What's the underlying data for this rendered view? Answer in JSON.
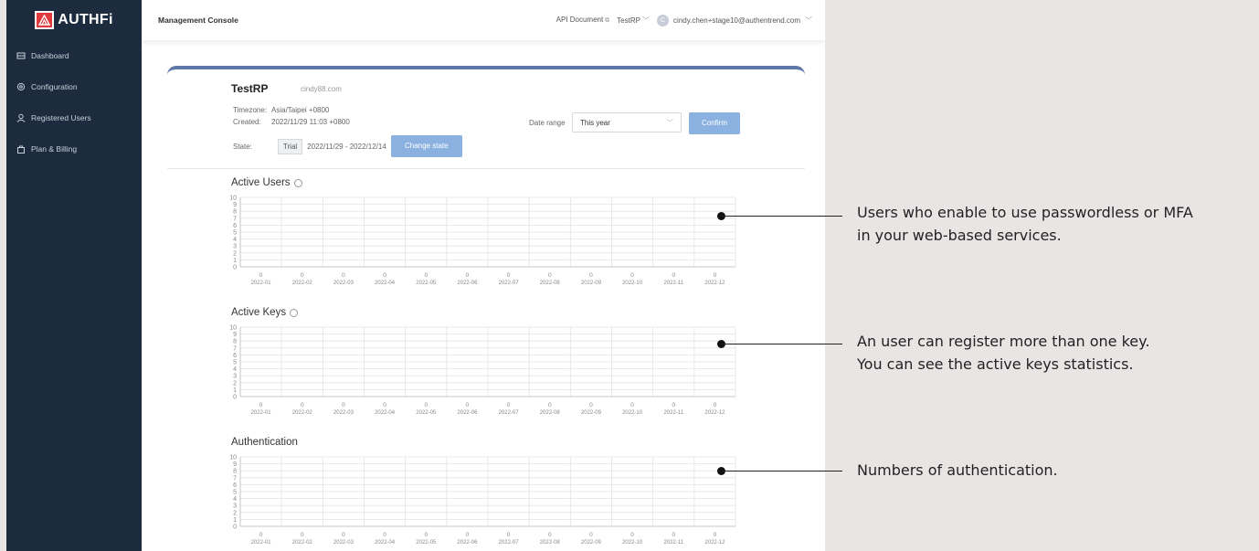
{
  "sidebar": {
    "logo_text": "AUTHFi",
    "items": [
      {
        "label": "Dashboard",
        "icon": "dashboard-icon"
      },
      {
        "label": "Configuration",
        "icon": "gear-icon"
      },
      {
        "label": "Registered Users",
        "icon": "user-icon"
      },
      {
        "label": "Plan & Billing",
        "icon": "bag-icon"
      }
    ]
  },
  "topbar": {
    "title": "Management Console",
    "api_docs": "API Document",
    "rp_select": "TestRP",
    "avatar_initial": "C",
    "user_email": "cindy.chen+stage10@authentrend.com"
  },
  "app": {
    "name": "TestRP",
    "domain": "cindy88.com",
    "timezone_label": "Timezone:",
    "timezone": "Asia/Taipei +0800",
    "created_label": "Created:",
    "created": "2022/11/29 11:03 +0800",
    "state_label": "State:",
    "state": "Trial",
    "state_range": "2022/11/29 - 2022/12/14",
    "change_state": "Change state"
  },
  "filter": {
    "date_range_label": "Date range",
    "date_range_value": "This year",
    "confirm": "Confirm"
  },
  "chart_data": [
    {
      "type": "bar",
      "title": "Active Users",
      "categories": [
        "2022-01",
        "2022-02",
        "2022-03",
        "2022-04",
        "2022-05",
        "2022-06",
        "2022-07",
        "2022-08",
        "2022-09",
        "2022-10",
        "2022-11",
        "2022-12"
      ],
      "values": [
        0,
        0,
        0,
        0,
        0,
        0,
        0,
        0,
        0,
        0,
        0,
        0
      ],
      "ylim": [
        0,
        10
      ],
      "yticks": [
        "10",
        "9",
        "8",
        "7",
        "6",
        "5",
        "4",
        "3",
        "2",
        "1",
        "0"
      ],
      "grid": true
    },
    {
      "type": "bar",
      "title": "Active Keys",
      "categories": [
        "2022-01",
        "2022-02",
        "2022-03",
        "2022-04",
        "2022-05",
        "2022-06",
        "2022-07",
        "2022-08",
        "2022-09",
        "2022-10",
        "2022-11",
        "2022-12"
      ],
      "values": [
        0,
        0,
        0,
        0,
        0,
        0,
        0,
        0,
        0,
        0,
        0,
        0
      ],
      "ylim": [
        0,
        10
      ],
      "yticks": [
        "10",
        "9",
        "8",
        "7",
        "6",
        "5",
        "4",
        "3",
        "2",
        "1",
        "0"
      ],
      "grid": true
    },
    {
      "type": "bar",
      "title": "Authentication",
      "categories": [
        "2022-01",
        "2022-02",
        "2022-03",
        "2022-04",
        "2022-05",
        "2022-06",
        "2022-07",
        "2022-08",
        "2022-09",
        "2022-10",
        "2022-11",
        "2022-12"
      ],
      "values": [
        0,
        0,
        0,
        0,
        0,
        0,
        0,
        0,
        0,
        0,
        0,
        0
      ],
      "ylim": [
        0,
        10
      ],
      "yticks": [
        "10",
        "9",
        "8",
        "7",
        "6",
        "5",
        "4",
        "3",
        "2",
        "1",
        "0"
      ],
      "grid": true
    }
  ],
  "annotations": {
    "active_users": [
      "Users who enable to use passwordless or MFA",
      "in your web-based services."
    ],
    "active_keys": [
      "An user can register more than one key.",
      "You can see the active keys statistics."
    ],
    "authentication": [
      "Numbers of authentication."
    ]
  },
  "colors": {
    "sidebar_bg": "#1c2b3e",
    "accent": "#5c77a8",
    "button": "#8bb1e0",
    "logo_red": "#e0393e"
  }
}
